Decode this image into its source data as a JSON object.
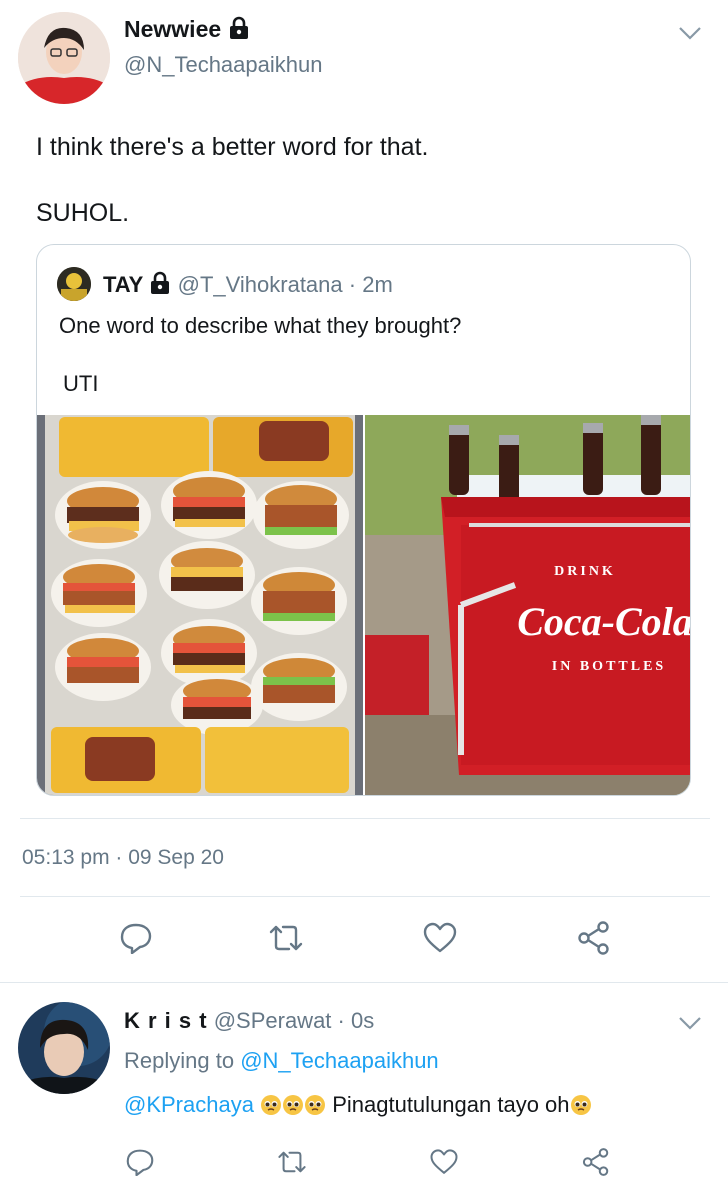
{
  "tweet": {
    "author_name": "Newwiee",
    "author_handle": "@N_Techaapaikhun",
    "text_line1": "I think there's a better word for that.",
    "text_line2": "SUHOL.",
    "timestamp": "05:13 pm · 09 Sep 20"
  },
  "quote": {
    "author_name": "TAY",
    "author_handle": "@T_Vihokratana",
    "time": "· 2m",
    "text_line1": "One word to describe what they brought?",
    "text_line2": "UTI",
    "image_left_alt": "tray of burgers and fries",
    "image_right_text_drink": "DRINK",
    "image_right_text_brand": "Coca-Cola",
    "image_right_text_bottles": "IN BOTTLES"
  },
  "reply": {
    "author_name": "K r i s t",
    "author_handle": "@SPerawat",
    "time": "· 0s",
    "replying_prefix": "Replying to",
    "replying_to": "@N_Techaapaikhun",
    "mention": "@KPrachaya",
    "text": "Pinagtutulungan tayo oh"
  },
  "icons": {
    "reply": "reply-icon",
    "retweet": "retweet-icon",
    "like": "like-icon",
    "share": "share-icon",
    "lock": "lock-icon",
    "caret": "chevron-down-icon"
  },
  "colors": {
    "text": "#14171a",
    "muted": "#657786",
    "link": "#1da1f2",
    "divider": "#e1e8ed"
  }
}
